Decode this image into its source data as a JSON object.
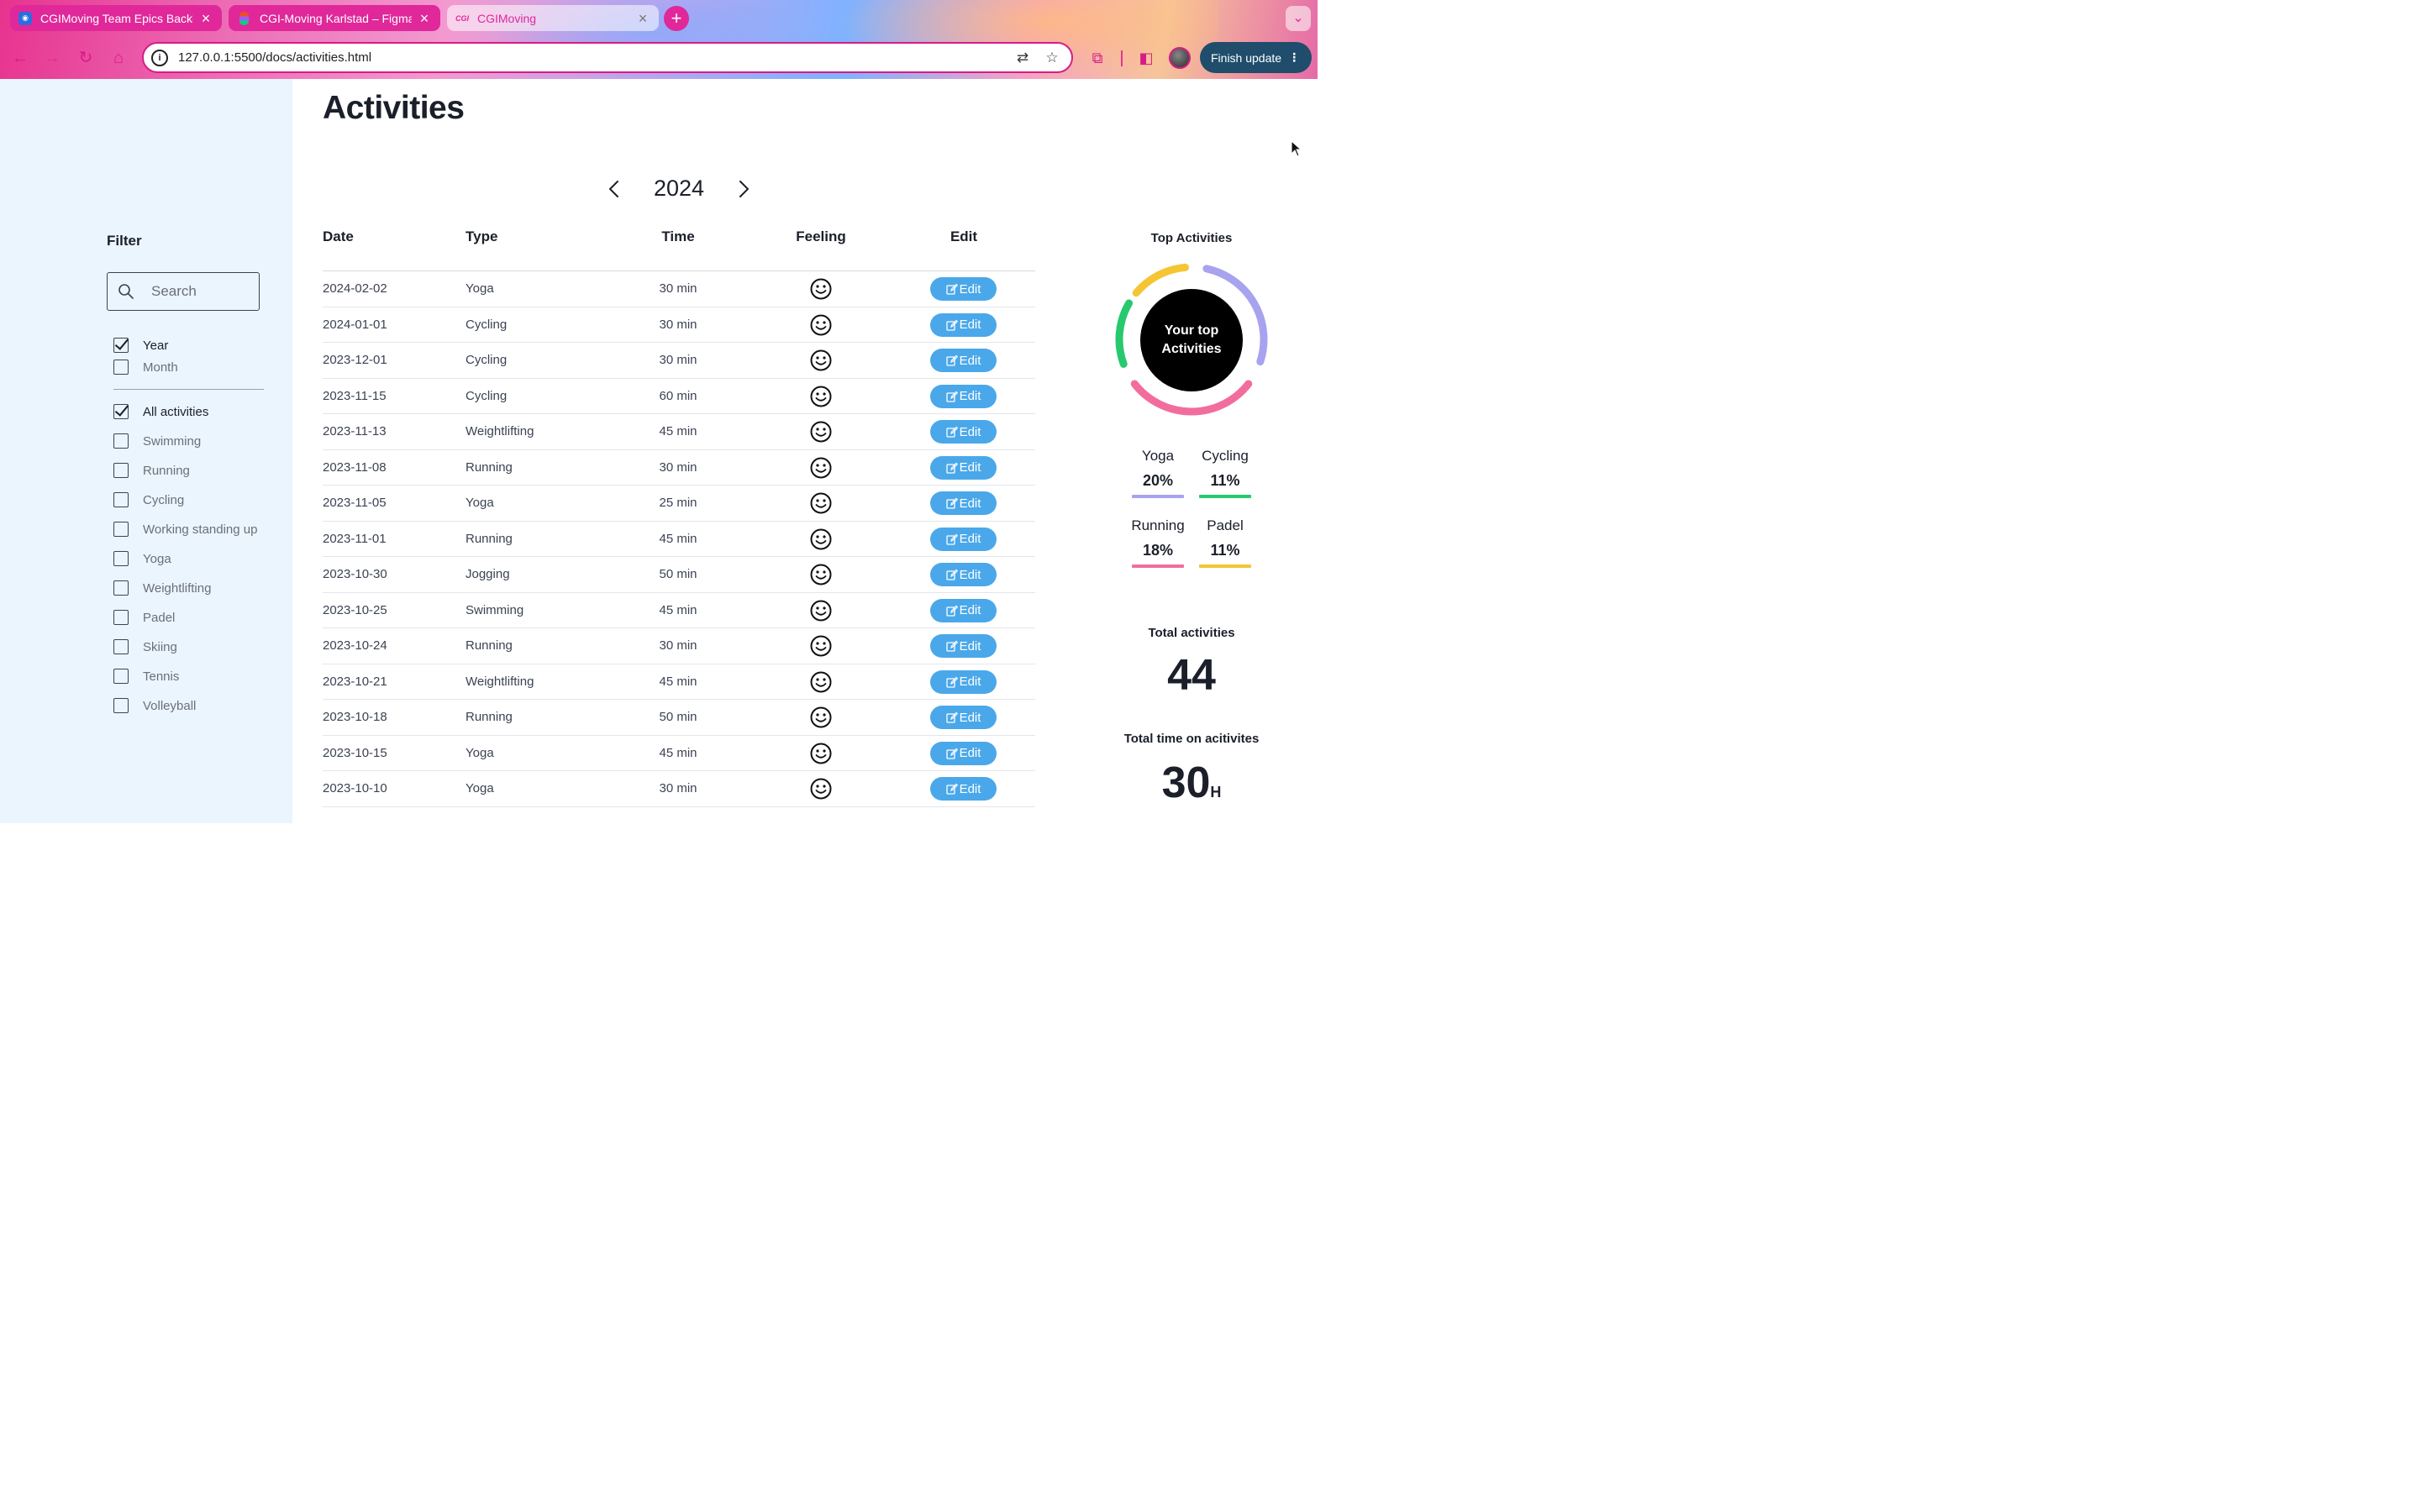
{
  "browser": {
    "tabs": [
      {
        "title": "CGIMoving Team Epics Backlog",
        "active": false
      },
      {
        "title": "CGI-Moving Karlstad – Figma",
        "active": false
      },
      {
        "title": "CGIMoving",
        "active": true
      }
    ],
    "url": "127.0.0.1:5500/docs/activities.html",
    "finish_update_label": "Finish update",
    "accent": "#d81b87"
  },
  "sidebar": {
    "filter_title": "Filter",
    "search_placeholder": "Search",
    "period": [
      {
        "label": "Year",
        "checked": true
      },
      {
        "label": "Month",
        "checked": false
      }
    ],
    "activities": [
      {
        "label": "All activities",
        "checked": true
      },
      {
        "label": "Swimming",
        "checked": false
      },
      {
        "label": "Running",
        "checked": false
      },
      {
        "label": "Cycling",
        "checked": false
      },
      {
        "label": "Working standing up",
        "checked": false
      },
      {
        "label": "Yoga",
        "checked": false
      },
      {
        "label": "Weightlifting",
        "checked": false
      },
      {
        "label": "Padel",
        "checked": false
      },
      {
        "label": "Skiing",
        "checked": false
      },
      {
        "label": "Tennis",
        "checked": false
      },
      {
        "label": "Volleyball",
        "checked": false
      }
    ]
  },
  "main": {
    "title": "Activities",
    "year": "2024",
    "table": {
      "headers": {
        "date": "Date",
        "type": "Type",
        "time": "Time",
        "feeling": "Feeling",
        "edit": "Edit"
      },
      "edit_label": "Edit",
      "rows": [
        {
          "date": "2024-02-02",
          "type": "Yoga",
          "time": "30 min"
        },
        {
          "date": "2024-01-01",
          "type": "Cycling",
          "time": "30 min"
        },
        {
          "date": "2023-12-01",
          "type": "Cycling",
          "time": "30 min"
        },
        {
          "date": "2023-11-15",
          "type": "Cycling",
          "time": "60 min"
        },
        {
          "date": "2023-11-13",
          "type": "Weightlifting",
          "time": "45 min"
        },
        {
          "date": "2023-11-08",
          "type": "Running",
          "time": "30 min"
        },
        {
          "date": "2023-11-05",
          "type": "Yoga",
          "time": "25 min"
        },
        {
          "date": "2023-11-01",
          "type": "Running",
          "time": "45 min"
        },
        {
          "date": "2023-10-30",
          "type": "Jogging",
          "time": "50 min"
        },
        {
          "date": "2023-10-25",
          "type": "Swimming",
          "time": "45 min"
        },
        {
          "date": "2023-10-24",
          "type": "Running",
          "time": "30 min"
        },
        {
          "date": "2023-10-21",
          "type": "Weightlifting",
          "time": "45 min"
        },
        {
          "date": "2023-10-18",
          "type": "Running",
          "time": "50 min"
        },
        {
          "date": "2023-10-15",
          "type": "Yoga",
          "time": "45 min"
        },
        {
          "date": "2023-10-10",
          "type": "Yoga",
          "time": "30 min"
        }
      ]
    }
  },
  "top_activities": {
    "title": "Top Activities",
    "center_line1": "Your top",
    "center_line2": "Activities",
    "items": [
      {
        "name": "Yoga",
        "percent": "20%",
        "color": "#a7a3ee"
      },
      {
        "name": "Cycling",
        "percent": "11%",
        "color": "#26c96f"
      },
      {
        "name": "Running",
        "percent": "18%",
        "color": "#f26d9e"
      },
      {
        "name": "Padel",
        "percent": "11%",
        "color": "#f5c534"
      }
    ],
    "total_activities_label": "Total activities",
    "total_activities_value": "44",
    "total_time_label": "Total time on acitivites",
    "total_time_value": "30",
    "total_time_unit": "H"
  }
}
